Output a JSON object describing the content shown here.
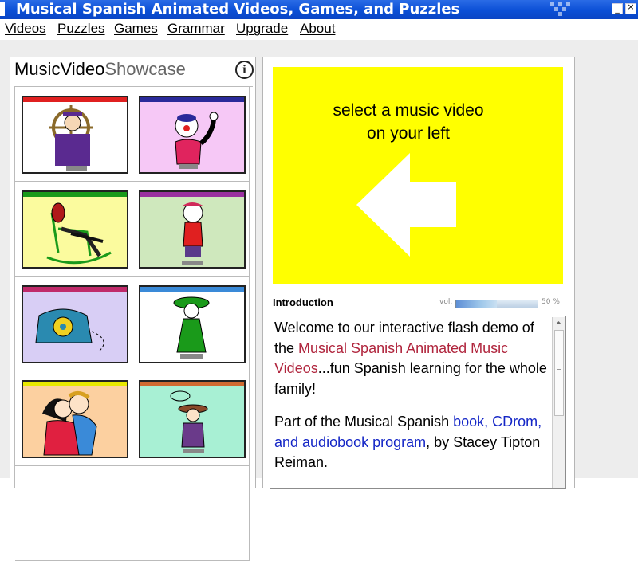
{
  "window": {
    "title": "Musical Spanish Animated Videos, Games, and Puzzles",
    "controls": [
      "minimize",
      "close"
    ]
  },
  "menu": {
    "items": [
      "Videos",
      "Puzzles",
      "Games",
      "Grammar",
      "Upgrade",
      "About"
    ]
  },
  "showcase": {
    "title_part1": "MusicVideo",
    "title_part2": "Showcase",
    "info_icon": "i",
    "thumbnails": [
      {
        "name": "sailor-video",
        "bar_color": "#e02020",
        "bg_color": "#ffffff"
      },
      {
        "name": "clown-video",
        "bar_color": "#2a2a9a",
        "bg_color": "#f6c8f6"
      },
      {
        "name": "rocking-chair-video",
        "bar_color": "#1a9a1a",
        "bg_color": "#fbfb9e"
      },
      {
        "name": "girl-cap-video",
        "bar_color": "#9a30a0",
        "bg_color": "#cfe8bd"
      },
      {
        "name": "telephone-video",
        "bar_color": "#c02a6a",
        "bg_color": "#d8cef5"
      },
      {
        "name": "sombrero-girl-video",
        "bar_color": "#3a8ad8",
        "bg_color": "#ffffff"
      },
      {
        "name": "couple-video",
        "bar_color": "#e8e800",
        "bg_color": "#fcd0a0"
      },
      {
        "name": "cowboy-video",
        "bar_color": "#d06a30",
        "bg_color": "#a8f0d4"
      }
    ]
  },
  "player": {
    "background_color": "#ffff00",
    "prompt_line1": "select a music video",
    "prompt_line2": "on your left",
    "arrow_icon": "left-arrow-icon"
  },
  "intro": {
    "label": "Introduction",
    "volume_label": "vol.",
    "volume_percent": 50,
    "volume_text": "50 %",
    "p1_a": "Welcome to our interactive flash demo of the ",
    "p1_link": "Musical Spanish Animated Music Videos",
    "p1_b": "...fun Spanish learning for the whole family!",
    "p2_a": "Part of the Musical Spanish ",
    "p2_link": "book, CDrom, and audiobook program",
    "p2_b": ", by Stacey Tipton Reiman."
  }
}
